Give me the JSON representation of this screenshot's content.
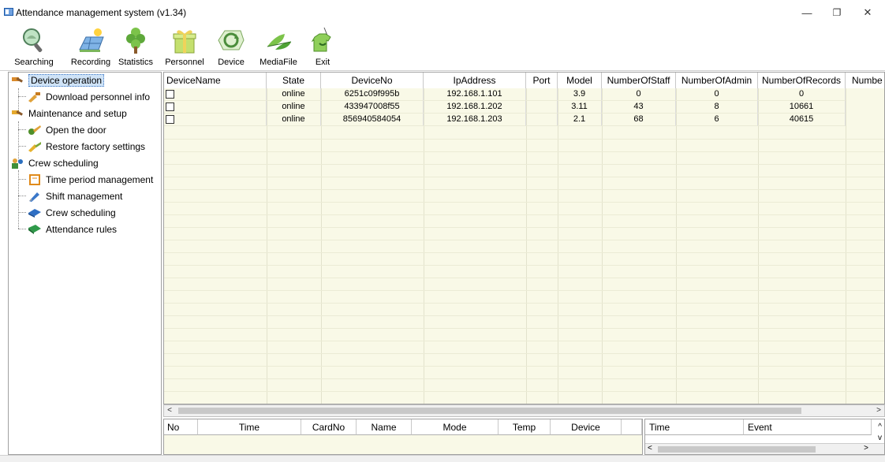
{
  "window": {
    "title": "Attendance management system (v1.34)",
    "minimize": "—",
    "restore": "❐",
    "close": "✕"
  },
  "toolbar": [
    {
      "label": "Searching",
      "icon": "magnifier-icon"
    },
    {
      "label": "Recording",
      "icon": "solar-panel-icon"
    },
    {
      "label": "Statistics",
      "icon": "tree-icon"
    },
    {
      "label": "Personnel",
      "icon": "gift-box-icon"
    },
    {
      "label": "Device",
      "icon": "recycle-icon"
    },
    {
      "label": "MediaFile",
      "icon": "leaf-icon"
    },
    {
      "label": "Exit",
      "icon": "exit-shirt-icon"
    }
  ],
  "sidebar": {
    "items": [
      {
        "label": "Device operation",
        "level": 0,
        "selected": true
      },
      {
        "label": "Download personnel info",
        "level": 1
      },
      {
        "label": "Maintenance and setup",
        "level": 0
      },
      {
        "label": "Open the door",
        "level": 1
      },
      {
        "label": "Restore factory settings",
        "level": 1
      },
      {
        "label": "Crew scheduling",
        "level": 0
      },
      {
        "label": "Time period management",
        "level": 1
      },
      {
        "label": "Shift management",
        "level": 1
      },
      {
        "label": "Crew scheduling",
        "level": 1
      },
      {
        "label": "Attendance rules",
        "level": 1
      }
    ]
  },
  "device_grid": {
    "columns": [
      "DeviceName",
      "State",
      "DeviceNo",
      "IpAddress",
      "Port",
      "Model",
      "NumberOfStaff",
      "NumberOfAdmin",
      "NumberOfRecords",
      "Numbe"
    ],
    "rows": [
      {
        "device_name": "",
        "state": "online",
        "device_no": "6251c09f995b",
        "ip": "192.168.1.101",
        "port": "",
        "model": "3.9",
        "staff": "0",
        "admin": "0",
        "records": "0",
        "extra": ""
      },
      {
        "device_name": "",
        "state": "online",
        "device_no": "433947008f55",
        "ip": "192.168.1.202",
        "port": "",
        "model": "3.11",
        "staff": "43",
        "admin": "8",
        "records": "10661",
        "extra": ""
      },
      {
        "device_name": "",
        "state": "online",
        "device_no": "856940584054",
        "ip": "192.168.1.203",
        "port": "",
        "model": "2.1",
        "staff": "68",
        "admin": "6",
        "records": "40615",
        "extra": ""
      }
    ]
  },
  "record_grid": {
    "columns": [
      "No",
      "Time",
      "CardNo",
      "Name",
      "Mode",
      "Temp",
      "Device",
      ""
    ]
  },
  "event_grid": {
    "columns": [
      "Time",
      "Event"
    ]
  },
  "scroll": {
    "left": "<",
    "right": ">",
    "up": "^",
    "down": "v"
  },
  "colors": {
    "grid_bg": "#f9f9e7",
    "selected": "#cfe3f7"
  }
}
